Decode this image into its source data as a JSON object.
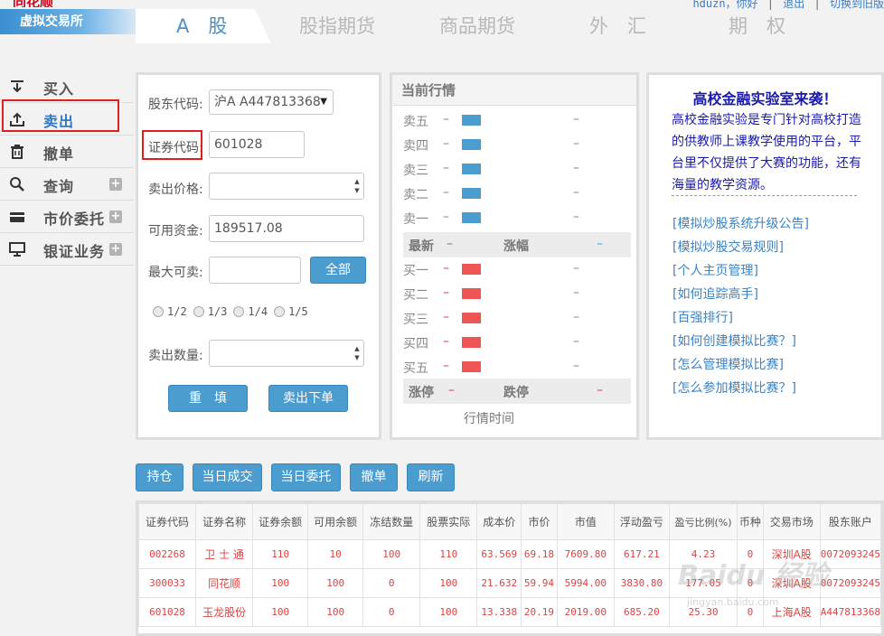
{
  "brand": {
    "logo_text": "同花顺",
    "subtitle": "虚拟交易所"
  },
  "user_bar": {
    "greeting": "hduzn，你好",
    "logout": "退出",
    "switch_old": "切换到旧版"
  },
  "main_tabs": [
    {
      "label": "A　股",
      "active": true
    },
    {
      "label": "股指期货",
      "active": false
    },
    {
      "label": "商品期货",
      "active": false
    },
    {
      "label": "外　汇",
      "active": false
    },
    {
      "label": "期　权",
      "active": false
    }
  ],
  "sidebar": {
    "items": [
      {
        "label": "买入",
        "icon": "download-tray-icon",
        "has_plus": false
      },
      {
        "label": "卖出",
        "icon": "upload-tray-icon",
        "has_plus": false,
        "active": true
      },
      {
        "label": "撤单",
        "icon": "trash-icon",
        "has_plus": false
      },
      {
        "label": "查询",
        "icon": "search-icon",
        "has_plus": true
      },
      {
        "label": "市价委托",
        "icon": "card-icon",
        "has_plus": true
      },
      {
        "label": "银证业务",
        "icon": "monitor-icon",
        "has_plus": true
      }
    ],
    "plus_glyph": "+"
  },
  "order_form": {
    "account_label": "股东代码:",
    "account_value": "沪A A447813368",
    "code_label": "证券代码",
    "code_colon": ":",
    "code_value": "601028",
    "price_label": "卖出价格:",
    "price_value": "",
    "funds_label": "可用资金:",
    "funds_value": "189517.08",
    "max_label": "最大可卖:",
    "max_value": "",
    "all_button": "全部",
    "fractions": [
      "1/2",
      "1/3",
      "1/4",
      "1/5"
    ],
    "qty_label": "卖出数量:",
    "qty_value": "",
    "reset_button": "重　填",
    "submit_button": "卖出下单"
  },
  "quote": {
    "title": "当前行情",
    "sell_levels": [
      "卖五",
      "卖四",
      "卖三",
      "卖二",
      "卖一"
    ],
    "buy_levels": [
      "买一",
      "买二",
      "买三",
      "买四",
      "买五"
    ],
    "dash": "–",
    "latest_label": "最新",
    "change_label": "涨幅",
    "limit_up_label": "涨停",
    "limit_down_label": "跌停",
    "time_label": "行情时间",
    "colors": {
      "sell_bar": "#4b9ccf",
      "buy_bar": "#ee5555"
    }
  },
  "news": {
    "title": "高校金融实验室来袭！",
    "body": "高校金融实验是专门针对高校打造的供教师上课教学使用的平台，平台里不仅提供了大赛的功能，还有海量的教学资源。",
    "links": [
      "[模拟炒股系统升级公告]",
      "[模拟炒股交易规则]",
      "[个人主页管理]",
      "[如何追踪高手]",
      "[百强排行]",
      "[如何创建模拟比赛？]",
      "[怎么管理模拟比赛]",
      "[怎么参加模拟比赛？]"
    ]
  },
  "bottom_tabs": [
    "持仓",
    "当日成交",
    "当日委托",
    "撤单",
    "刷新"
  ],
  "positions": {
    "columns": [
      "证券代码",
      "证券名称",
      "证券余额",
      "可用余额",
      "冻结数量",
      "股票实际",
      "成本价",
      "市价",
      "市值",
      "浮动盈亏",
      "盈亏比例(%)",
      "币种",
      "交易市场",
      "股东账户"
    ],
    "rows": [
      [
        "002268",
        "卫 士 通",
        "110",
        "10",
        "100",
        "110",
        "63.569",
        "69.18",
        "7609.80",
        "617.21",
        "4.23",
        "0",
        "深圳A股",
        "0072093245"
      ],
      [
        "300033",
        "同花顺",
        "100",
        "100",
        "0",
        "100",
        "21.632",
        "59.94",
        "5994.00",
        "3830.80",
        "177.05",
        "0",
        "深圳A股",
        "0072093245"
      ],
      [
        "601028",
        "玉龙股份",
        "100",
        "100",
        "0",
        "100",
        "13.338",
        "20.19",
        "2019.00",
        "685.20",
        "25.30",
        "0",
        "上海A股",
        "A447813368"
      ]
    ]
  },
  "watermark": {
    "text": "Baidu 经验",
    "sub": "jingyan.baidu.com"
  },
  "accent_colors": {
    "brand_blue": "#4b9ccf",
    "highlight_red": "#e02020",
    "loss_red": "#d64545"
  }
}
